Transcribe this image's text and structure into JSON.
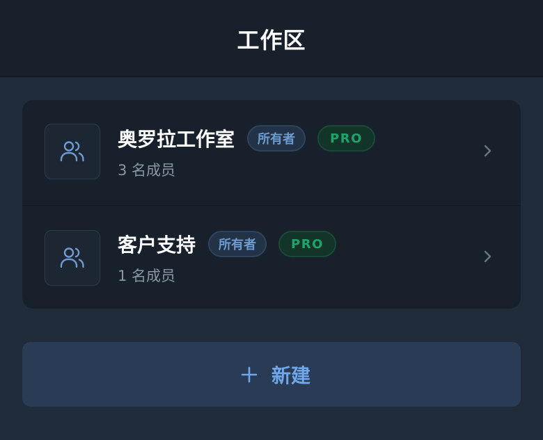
{
  "header": {
    "title": "工作区"
  },
  "workspaces": [
    {
      "name": "奥罗拉工作室",
      "role_badge": "所有者",
      "plan_badge": "PRO",
      "member_count": "3 名成员",
      "icon": "users-icon"
    },
    {
      "name": "客户支持",
      "role_badge": "所有者",
      "plan_badge": "PRO",
      "member_count": "1 名成员",
      "icon": "users-icon"
    }
  ],
  "actions": {
    "new_label": "新建",
    "new_icon": "plus-icon"
  },
  "colors": {
    "background": "#212c3a",
    "header": "#18202b",
    "card": "#18202b",
    "owner_badge_text": "#6e9bd0",
    "pro_badge_text": "#1ba46c",
    "accent": "#6fa7e8",
    "new_button_bg": "#2a3c55"
  }
}
